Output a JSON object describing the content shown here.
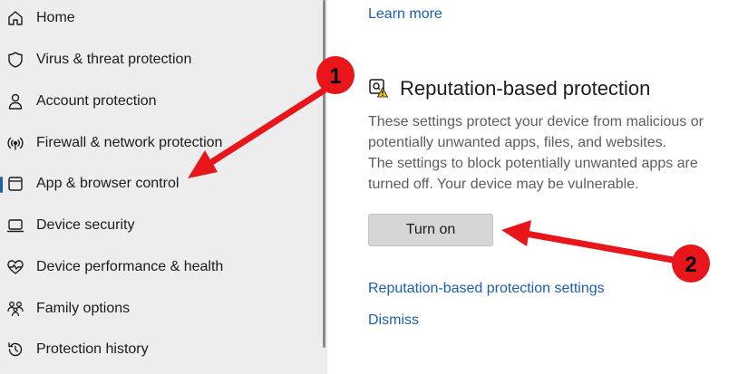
{
  "sidebar": {
    "items": [
      {
        "label": "Home",
        "icon": "home-icon"
      },
      {
        "label": "Virus & threat protection",
        "icon": "shield-icon"
      },
      {
        "label": "Account protection",
        "icon": "person-icon"
      },
      {
        "label": "Firewall & network protection",
        "icon": "wireless-icon"
      },
      {
        "label": "App & browser control",
        "icon": "app-window-icon",
        "active": true
      },
      {
        "label": "Device security",
        "icon": "laptop-icon"
      },
      {
        "label": "Device performance & health",
        "icon": "heart-pulse-icon"
      },
      {
        "label": "Family options",
        "icon": "family-icon"
      },
      {
        "label": "Protection history",
        "icon": "history-icon"
      }
    ]
  },
  "main": {
    "learn_more": "Learn more",
    "section_title": "Reputation-based protection",
    "section_icon": "reputation-warning-icon",
    "description": [
      "These settings protect your device from malicious or potentially unwanted apps, files, and websites.",
      "The settings to block potentially unwanted apps are turned off. Your device may be vulnerable."
    ],
    "turn_on_label": "Turn on",
    "settings_link": "Reputation-based protection settings",
    "dismiss_link": "Dismiss"
  },
  "annotations": {
    "badge_1": "1",
    "badge_2": "2",
    "color": "#e8151b"
  },
  "colors": {
    "accent": "#1a5fb4",
    "sidebar_bg": "#ededed",
    "button_bg": "#d6d6d6"
  }
}
